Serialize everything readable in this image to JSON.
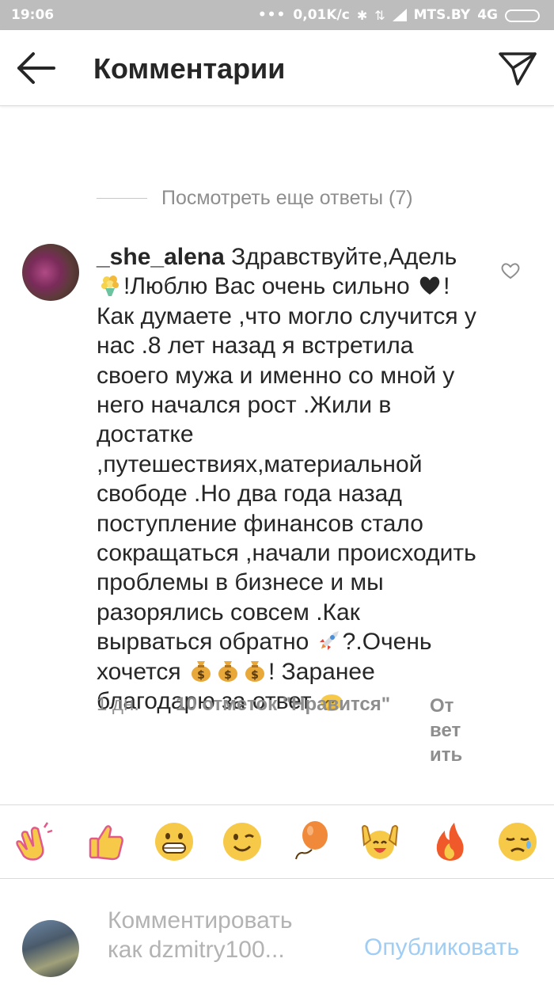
{
  "status_bar": {
    "time": "19:06",
    "dots": "•••",
    "speed": "0,01K/c",
    "carrier": "MTS.BY",
    "network": "4G"
  },
  "header": {
    "title": "Комментарии",
    "back_icon": "arrow-left-icon",
    "direct_icon": "paper-plane-icon"
  },
  "more_replies": {
    "label": "Посмотреть еще ответы (7)"
  },
  "comment": {
    "username": "_she_alena",
    "text_1": " Здравствуйте,Адель ",
    "text_2": "!Люблю Вас очень сильно ",
    "text_3": "! Как думаете ,что могло случится у нас .8 лет назад я встретила своего мужа и именно со мной у него начался рост .Жили в достатке ,путешествиях,материальной свободе .Но два года назад поступление финансов стало сокращаться ,начали происходить проблемы в бизнесе и мы разорялись совсем .Как вырваться обратно ",
    "text_4": "?.Очень хочется ",
    "text_5": "! Заранее благодарю за ответ ",
    "emojis": [
      "bouquet-icon",
      "heart-icon",
      "rocket-icon",
      "money-bag-icon",
      "money-bag-icon",
      "money-bag-icon",
      "pray-icon"
    ],
    "time": "1 дн.",
    "likes": "10 отметок \"Нравится\"",
    "reply": "Ответить"
  },
  "quick_emojis": [
    "clapping-hands-icon",
    "thumbs-up-icon",
    "grinning-face-icon",
    "winking-face-icon",
    "balloon-icon",
    "raised-hands-icon",
    "fire-icon",
    "sad-face-icon"
  ],
  "composer": {
    "placeholder_line1": "Комментировать",
    "placeholder_line2": "как dzmitry100...",
    "publish_label": "Опубликовать"
  },
  "colors": {
    "link_disabled": "#9fcdf3",
    "secondary_text": "#8e8e8e",
    "status_bar_bg": "#bdbdbd"
  }
}
